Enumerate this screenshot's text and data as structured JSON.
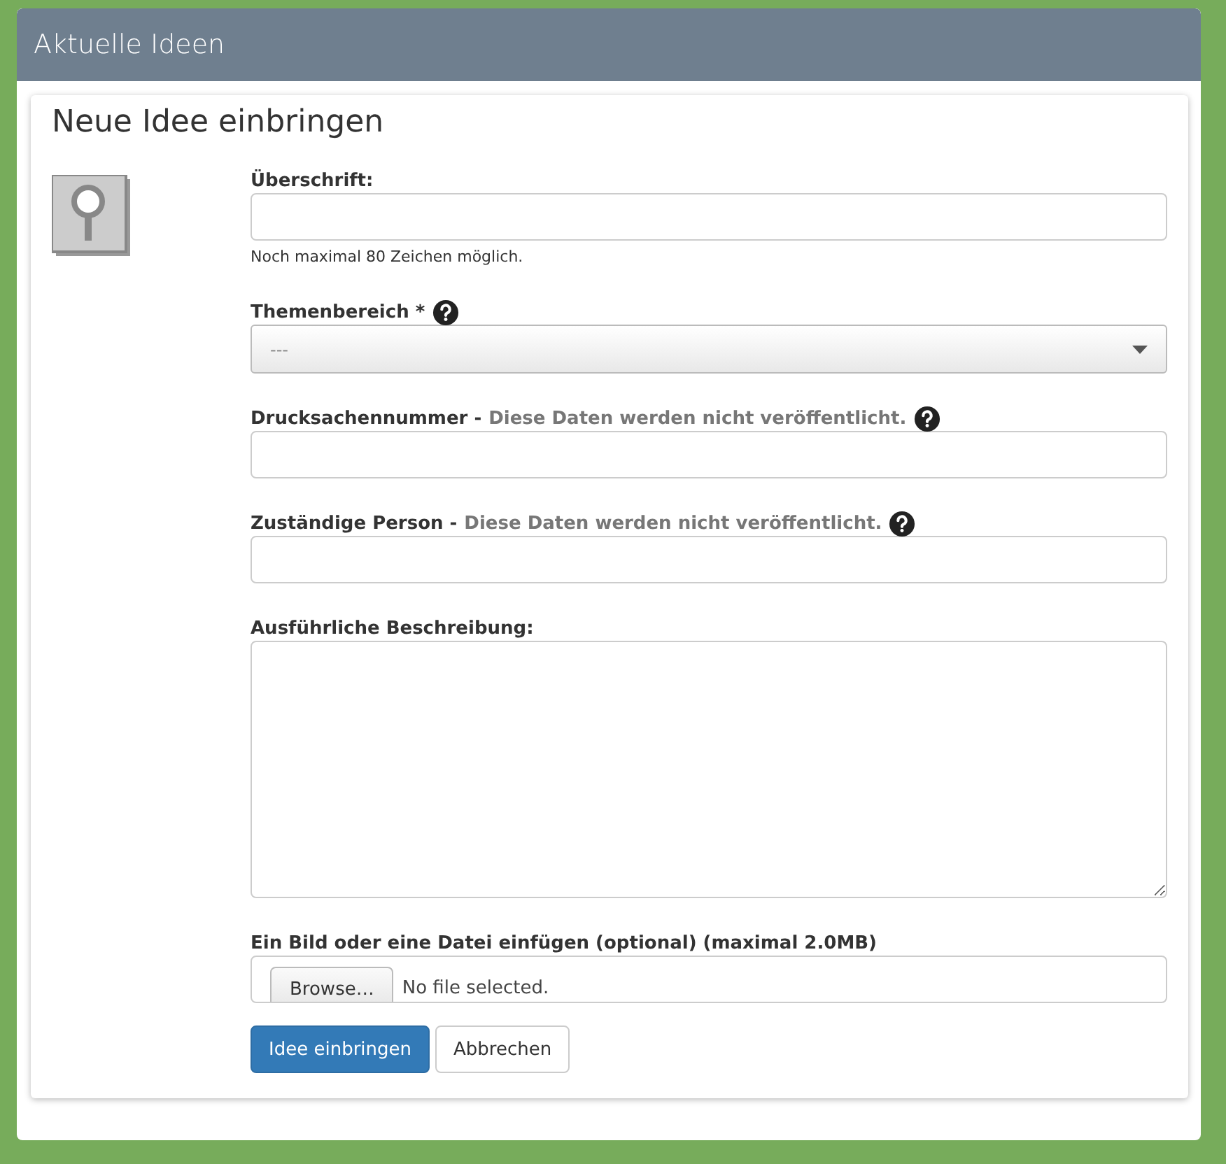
{
  "panel": {
    "title": "Aktuelle Ideen"
  },
  "card": {
    "title": "Neue Idee einbringen"
  },
  "fields": [
    {
      "kind": "text",
      "label": "Überschrift:",
      "help": false,
      "hint": "Noch maximal 80 Zeichen möglich."
    },
    {
      "kind": "select",
      "label": "Themenbereich *",
      "help": true,
      "value": "---"
    },
    {
      "kind": "text",
      "label": "Drucksachennummer -",
      "note": "Diese Daten werden nicht veröffentlicht.",
      "help": true
    },
    {
      "kind": "text",
      "label": "Zuständige Person -",
      "note": "Diese Daten werden nicht veröffentlicht.",
      "help": true
    },
    {
      "kind": "textarea",
      "label": "Ausführliche Beschreibung:",
      "help": false
    },
    {
      "kind": "file",
      "label": "Ein Bild oder eine Datei einfügen (optional) (maximal 2.0MB)",
      "help": false,
      "button": "Browse…",
      "status": "No file selected."
    }
  ],
  "buttons": [
    {
      "kind": "primary",
      "label": "Idee einbringen"
    },
    {
      "kind": "default",
      "label": "Abbrechen"
    }
  ]
}
